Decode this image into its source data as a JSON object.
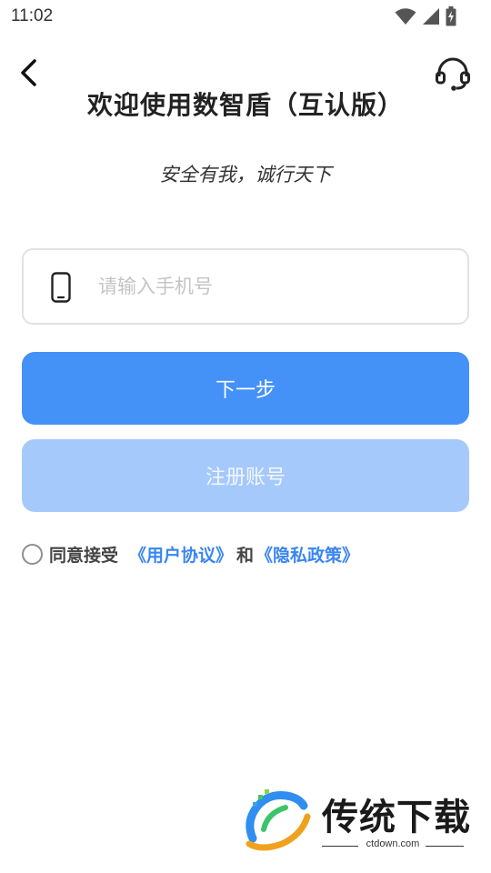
{
  "status_bar": {
    "time": "11:02",
    "icons": [
      "wifi-icon",
      "cellular-signal-icon",
      "battery-charging-icon"
    ]
  },
  "header": {
    "back_icon": "chevron-left-icon",
    "support_icon": "headset-icon",
    "title": "欢迎使用数智盾（互认版）",
    "slogan": "安全有我，诚行天下"
  },
  "phone_field": {
    "icon": "mobile-phone-icon",
    "value": "",
    "placeholder": "请输入手机号"
  },
  "buttons": {
    "next_label": "下一步",
    "register_label": "注册账号"
  },
  "agreement": {
    "checked": false,
    "prefix": "同意接受",
    "user_agreement": "《用户协议》",
    "conjunction": "和",
    "privacy_policy": "《隐私政策》"
  },
  "watermark": {
    "title": "传统下载",
    "url": "ctdown.com"
  },
  "colors": {
    "primary": "#4491f7",
    "primary_disabled": "#a6c9fb",
    "link": "#3a86f0",
    "border": "#e2e2e2"
  }
}
